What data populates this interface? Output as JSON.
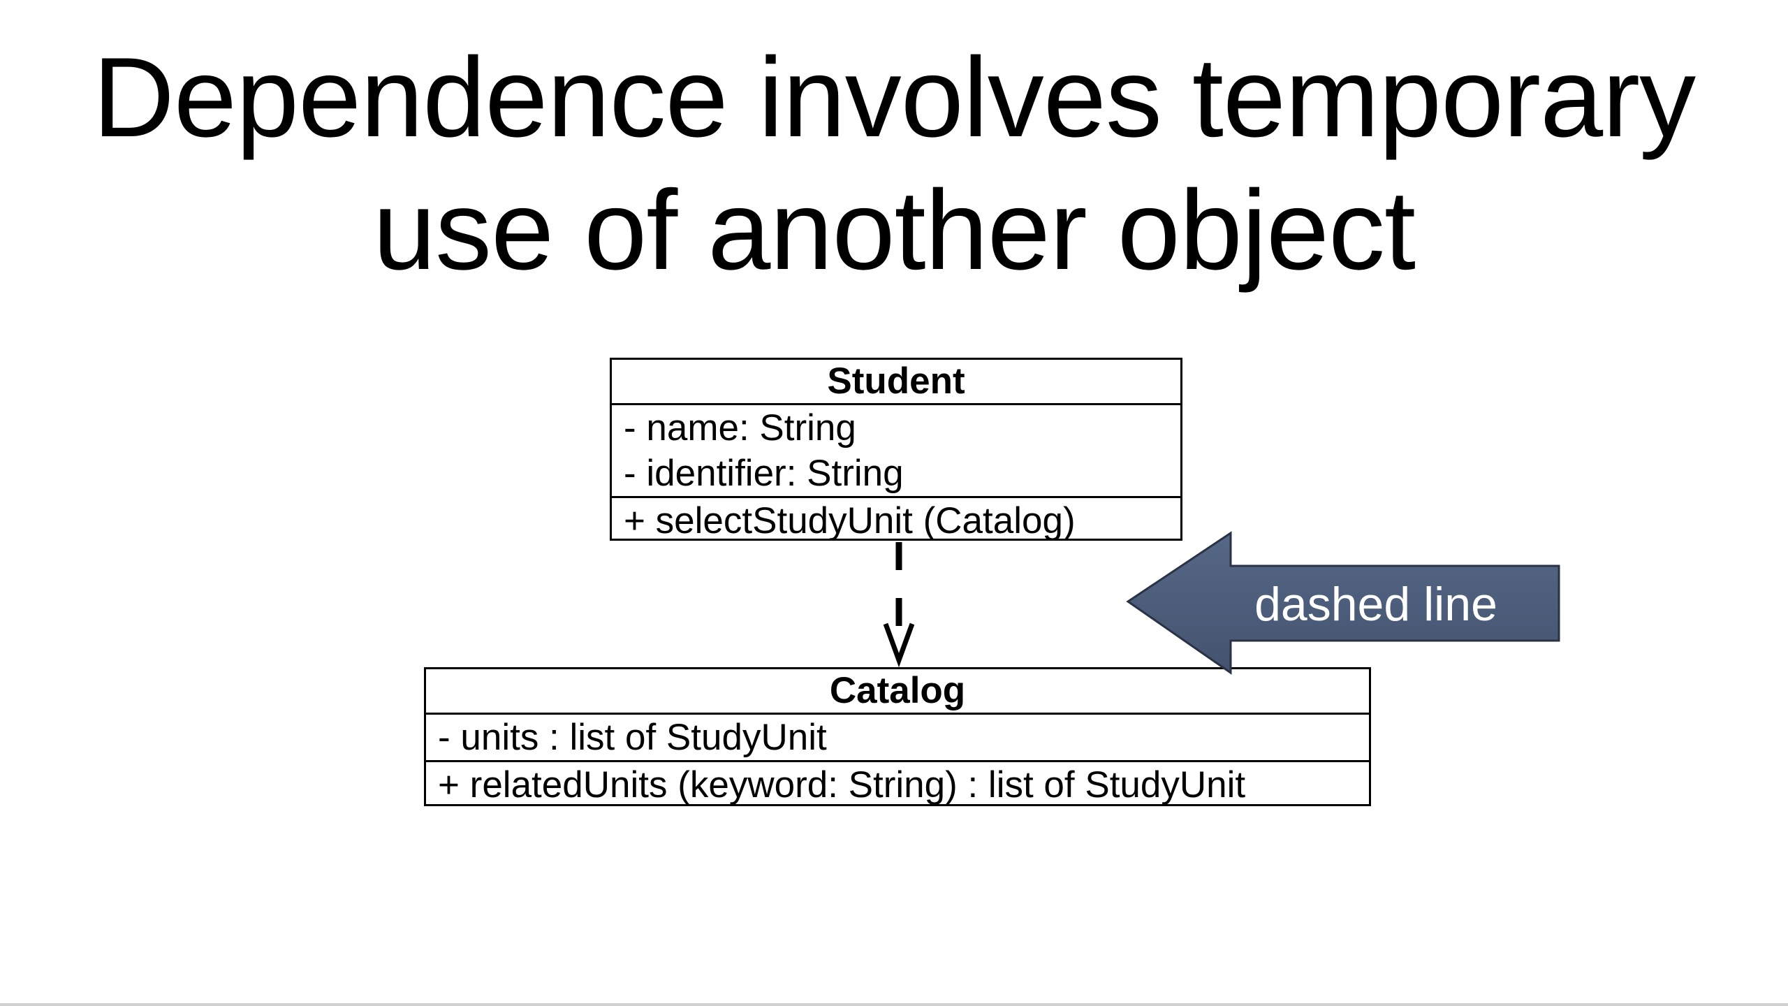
{
  "slide": {
    "title_lines": [
      "Dependence involves temporary",
      "use of another object"
    ]
  },
  "diagram": {
    "student": {
      "name": "Student",
      "attributes": [
        "- name: String",
        "- identifier: String"
      ],
      "operations": [
        "+ selectStudyUnit (Catalog)"
      ]
    },
    "catalog": {
      "name": "Catalog",
      "attributes": [
        "- units : list of StudyUnit"
      ],
      "operations": [
        "+ relatedUnits (keyword: String) : list of StudyUnit"
      ]
    },
    "relationship": "dependency"
  },
  "callout": {
    "label": "dashed line",
    "color": "#4a5b78"
  }
}
